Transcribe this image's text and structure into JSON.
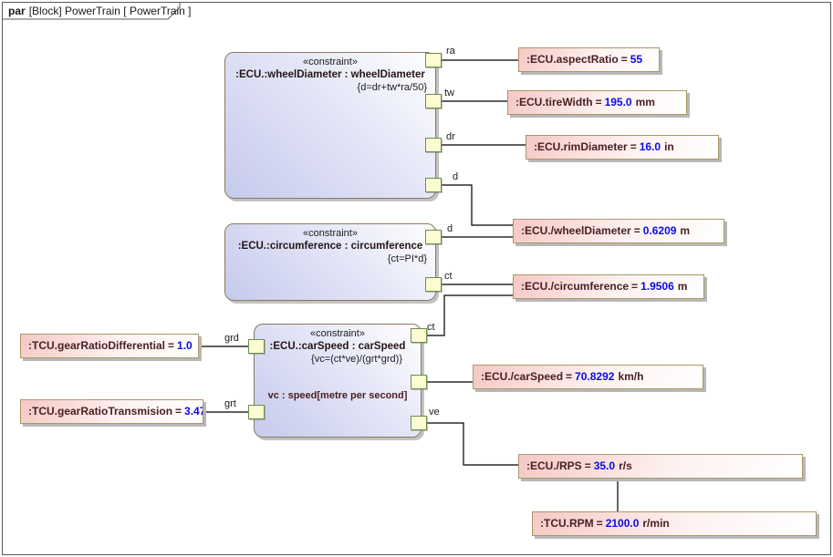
{
  "frame": {
    "keyword": "par",
    "title": "[Block] PowerTrain [ PowerTrain ]"
  },
  "colors": {
    "value_text": "#0a0ae6",
    "label_text": "#4a2022",
    "constraint_fill": "#c6caec",
    "value_box_fill": "#f6c8c5",
    "port_fill": "#fcfcd2",
    "port_border": "#6a8f4d",
    "frame_border": "#5a5a5a"
  },
  "ui": {
    "equals": "="
  },
  "constraint_blocks": [
    {
      "stereotype": "«constraint»",
      "name": ":ECU.:wheelDiameter : wheelDiameter",
      "expression": "{d=dr+tw*ra/50}"
    },
    {
      "stereotype": "«constraint»",
      "name": ":ECU.:circumference : circumference",
      "expression": "{ct=PI*d}"
    },
    {
      "stereotype": "«constraint»",
      "name": ":ECU.:carSpeed : carSpeed",
      "expression": "{vc=(ct*ve)/(grt*grd)}",
      "parameter_note": "vc : speed[metre per second]"
    }
  ],
  "value_boxes": [
    {
      "label": ":ECU.aspectRatio",
      "value": "55",
      "unit": ""
    },
    {
      "label": ":ECU.tireWidth",
      "value": "195.0",
      "unit": "mm"
    },
    {
      "label": ":ECU.rimDiameter",
      "value": "16.0",
      "unit": "in"
    },
    {
      "label": ":ECU./wheelDiameter",
      "value": "0.6209",
      "unit": "m"
    },
    {
      "label": ":ECU./circumference",
      "value": "1.9506",
      "unit": "m"
    },
    {
      "label": ":ECU./carSpeed",
      "value": "70.8292",
      "unit": "km/h"
    },
    {
      "label": ":ECU./RPS",
      "value": "35.0",
      "unit": "r/s"
    },
    {
      "label": ":TCU.RPM",
      "value": "2100.0",
      "unit": "r/min"
    },
    {
      "label": ":TCU.gearRatioDifferential",
      "value": "1.0",
      "unit": ""
    },
    {
      "label": ":TCU.gearRatioTransmision",
      "value": "3.47",
      "unit": ""
    }
  ],
  "port_labels": {
    "ra": "ra",
    "tw": "tw",
    "dr": "dr",
    "d1": "d",
    "d2": "d",
    "ct2": "ct",
    "ct3": "ct",
    "ve": "ve",
    "grd": "grd",
    "grt": "grt"
  }
}
